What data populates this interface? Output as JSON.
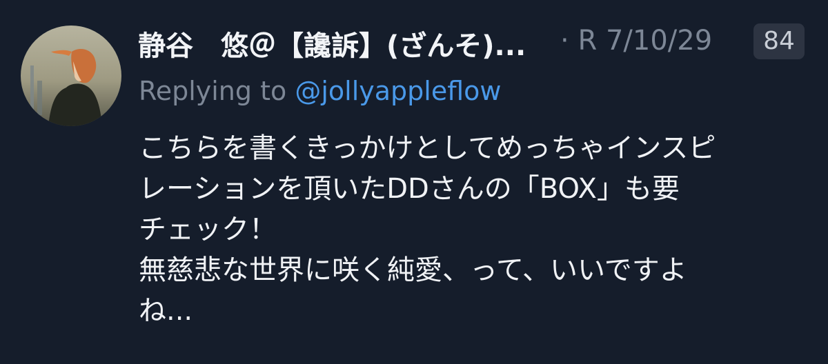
{
  "tweet": {
    "display_name": "静谷　悠＠【讒訴】(ざんそ)...",
    "separator": "·",
    "date": "R 7/10/29",
    "reply_count": "84",
    "replying_prefix": "Replying to",
    "replying_handle": "@jollyappleflow",
    "body_lines": [
      "こちらを書くきっかけとしてめっちゃインスピ",
      "レーションを頂いたDDさんの「BOX」も要",
      "チェック！",
      "無慈悲な世界に咲く純愛、って、いいですよ",
      "ね..."
    ]
  },
  "colors": {
    "background": "#151d2b",
    "handle": "#4a99e9",
    "muted": "#7d8796"
  }
}
